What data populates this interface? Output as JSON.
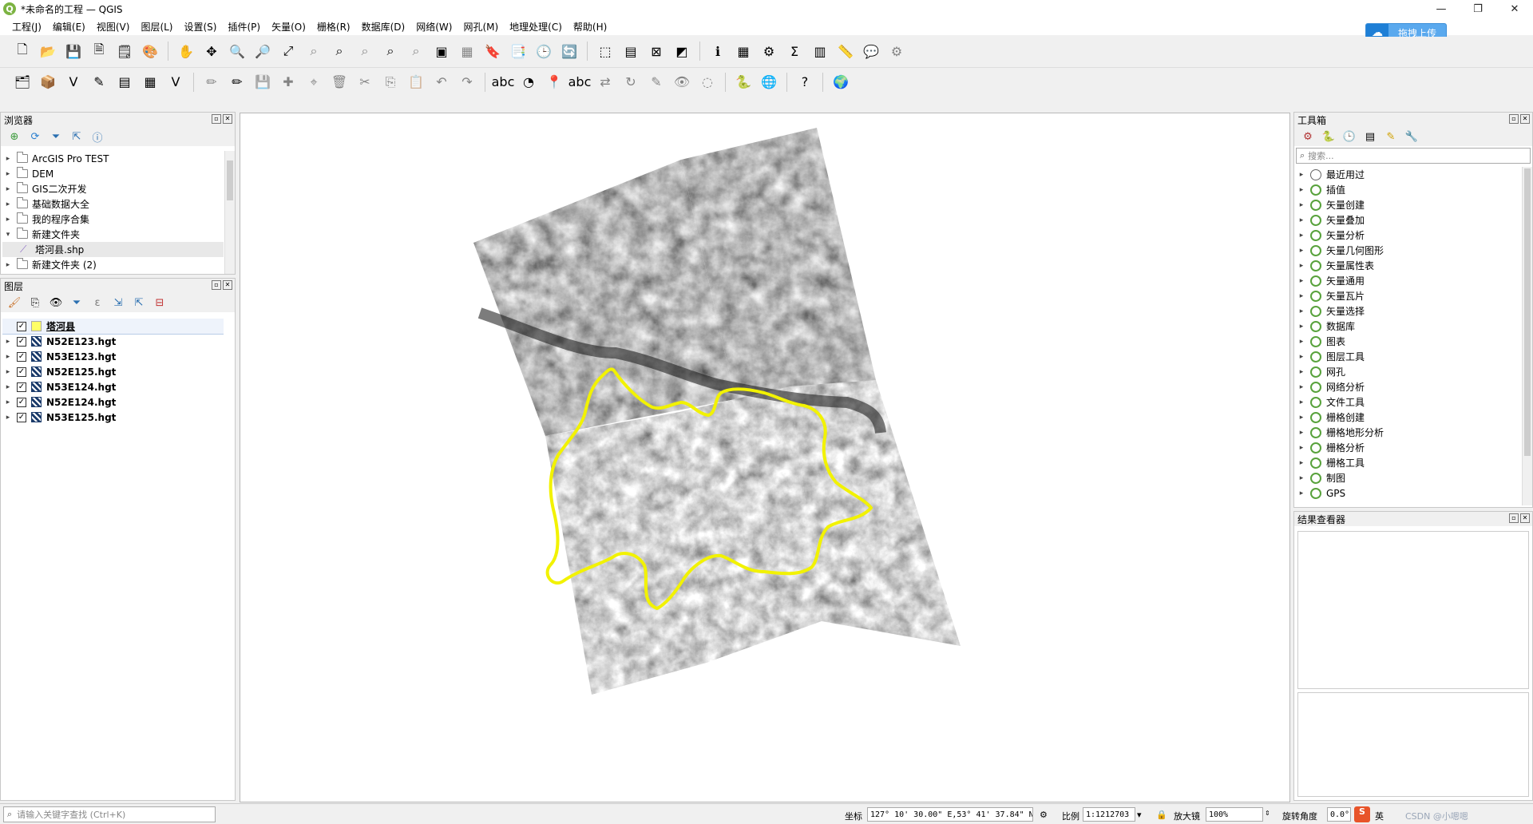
{
  "window": {
    "title": "*未命名的工程 — QGIS",
    "logo": "Q",
    "min": "—",
    "max": "❐",
    "close": "✕"
  },
  "menu": [
    "工程(J)",
    "编辑(E)",
    "视图(V)",
    "图层(L)",
    "设置(S)",
    "插件(P)",
    "矢量(O)",
    "栅格(R)",
    "数据库(D)",
    "网络(W)",
    "网孔(M)",
    "地理处理(C)",
    "帮助(H)"
  ],
  "upload_button": {
    "label": "拖拽上传",
    "icon": "☁"
  },
  "toolbar1": [
    {
      "name": "new-project-icon",
      "glyph": "🗋"
    },
    {
      "name": "open-project-icon",
      "glyph": "📂"
    },
    {
      "name": "save-project-icon",
      "glyph": "💾"
    },
    {
      "name": "save-as-icon",
      "glyph": "🗎"
    },
    {
      "name": "layout-icon",
      "glyph": "🗒"
    },
    {
      "name": "style-manager-icon",
      "glyph": "🎨"
    },
    {
      "sep": true
    },
    {
      "name": "pan-icon",
      "glyph": "✋"
    },
    {
      "name": "pan-to-selection-icon",
      "glyph": "✥"
    },
    {
      "name": "zoom-in-icon",
      "glyph": "🔍"
    },
    {
      "name": "zoom-out-icon",
      "glyph": "🔎"
    },
    {
      "name": "zoom-full-icon",
      "glyph": "⤢"
    },
    {
      "name": "zoom-selection-icon",
      "glyph": "⌕",
      "dim": true
    },
    {
      "name": "zoom-layer-icon",
      "glyph": "⌕"
    },
    {
      "name": "zoom-native-icon",
      "glyph": "⌕",
      "dim": true
    },
    {
      "name": "zoom-last-icon",
      "glyph": "⌕"
    },
    {
      "name": "zoom-next-icon",
      "glyph": "⌕",
      "dim": true
    },
    {
      "name": "new-map-view-icon",
      "glyph": "▣"
    },
    {
      "name": "new-3d-view-icon",
      "glyph": "▦",
      "dim": true
    },
    {
      "name": "bookmark-icon",
      "glyph": "🔖"
    },
    {
      "name": "show-bookmarks-icon",
      "glyph": "📑"
    },
    {
      "name": "temporal-icon",
      "glyph": "🕒"
    },
    {
      "name": "refresh-icon",
      "glyph": "🔄"
    },
    {
      "sep": true
    },
    {
      "name": "select-features-icon",
      "glyph": "⬚"
    },
    {
      "name": "select-value-icon",
      "glyph": "▤"
    },
    {
      "name": "deselect-icon",
      "glyph": "⊠"
    },
    {
      "name": "select-location-icon",
      "glyph": "◩"
    },
    {
      "sep": true
    },
    {
      "name": "identify-icon",
      "glyph": "ℹ"
    },
    {
      "name": "attribute-table-icon",
      "glyph": "▦"
    },
    {
      "name": "toolbox-icon",
      "glyph": "⚙"
    },
    {
      "name": "statistics-icon",
      "glyph": "Σ"
    },
    {
      "name": "field-calculator-icon",
      "glyph": "▥"
    },
    {
      "name": "measure-icon",
      "glyph": "📏"
    },
    {
      "name": "annotation-icon",
      "glyph": "💬"
    },
    {
      "name": "tips-icon",
      "glyph": "⚙",
      "dim": true
    }
  ],
  "toolbar2": [
    {
      "name": "data-source-manager-icon",
      "glyph": "🗂"
    },
    {
      "name": "new-geopackage-icon",
      "glyph": "📦"
    },
    {
      "name": "new-shapefile-icon",
      "glyph": "V"
    },
    {
      "name": "new-temp-layer-icon",
      "glyph": "✎"
    },
    {
      "name": "new-virtual-layer-icon",
      "glyph": "▤"
    },
    {
      "name": "mesh-icon",
      "glyph": "▦"
    },
    {
      "name": "add-vector-icon",
      "glyph": "V"
    },
    {
      "sep": true
    },
    {
      "name": "current-edits-icon",
      "glyph": "✏",
      "dim": true
    },
    {
      "name": "toggle-editing-icon",
      "glyph": "✏"
    },
    {
      "name": "save-edits-icon",
      "glyph": "💾",
      "dim": true
    },
    {
      "name": "add-feature-icon",
      "glyph": "✚",
      "dim": true
    },
    {
      "name": "vertex-tool-icon",
      "glyph": "⌖",
      "dim": true
    },
    {
      "name": "delete-selected-icon",
      "glyph": "🗑",
      "dim": true
    },
    {
      "name": "cut-icon",
      "glyph": "✂",
      "dim": true
    },
    {
      "name": "copy-icon",
      "glyph": "⎘",
      "dim": true
    },
    {
      "name": "paste-icon",
      "glyph": "📋",
      "dim": true
    },
    {
      "name": "undo-icon",
      "glyph": "↶",
      "dim": true
    },
    {
      "name": "redo-icon",
      "glyph": "↷",
      "dim": true
    },
    {
      "sep": true
    },
    {
      "name": "label-icon",
      "glyph": "abc"
    },
    {
      "name": "diagram-icon",
      "glyph": "◔"
    },
    {
      "name": "pin-label-icon",
      "glyph": "📍"
    },
    {
      "name": "highlight-label-icon",
      "glyph": "abc"
    },
    {
      "name": "move-label-icon",
      "glyph": "⇄",
      "dim": true
    },
    {
      "name": "rotate-label-icon",
      "glyph": "↻",
      "dim": true
    },
    {
      "name": "change-label-icon",
      "glyph": "✎",
      "dim": true
    },
    {
      "name": "show-label-icon",
      "glyph": "👁",
      "dim": true
    },
    {
      "name": "hide-label-icon",
      "glyph": "◌",
      "dim": true
    },
    {
      "sep": true
    },
    {
      "name": "python-icon",
      "glyph": "🐍"
    },
    {
      "name": "globe-icon",
      "glyph": "🌐"
    },
    {
      "sep": true
    },
    {
      "name": "help-icon",
      "glyph": "?"
    },
    {
      "sep": true
    },
    {
      "name": "web-icon",
      "glyph": "🌍"
    }
  ],
  "browser": {
    "title": "浏览器",
    "items": [
      {
        "label": "ArcGIS Pro TEST",
        "arrow": "▸",
        "type": "folder"
      },
      {
        "label": "DEM",
        "arrow": "▸",
        "type": "folder"
      },
      {
        "label": "GIS二次开发",
        "arrow": "▸",
        "type": "folder"
      },
      {
        "label": "基础数据大全",
        "arrow": "▸",
        "type": "folder"
      },
      {
        "label": "我的程序合集",
        "arrow": "▸",
        "type": "folder"
      },
      {
        "label": "新建文件夹",
        "arrow": "▾",
        "type": "folder"
      },
      {
        "label": "塔河县.shp",
        "arrow": "",
        "type": "shp",
        "selected": true
      },
      {
        "label": "新建文件夹 (2)",
        "arrow": "▸",
        "type": "folder"
      }
    ]
  },
  "layers": {
    "title": "图层",
    "items": [
      {
        "label": "塔河县",
        "type": "vector",
        "checked": "✓",
        "selected": true
      },
      {
        "label": "N52E123.hgt",
        "type": "raster",
        "checked": "✓"
      },
      {
        "label": "N53E123.hgt",
        "type": "raster",
        "checked": "✓"
      },
      {
        "label": "N52E125.hgt",
        "type": "raster",
        "checked": "✓"
      },
      {
        "label": "N53E124.hgt",
        "type": "raster",
        "checked": "✓"
      },
      {
        "label": "N52E124.hgt",
        "type": "raster",
        "checked": "✓"
      },
      {
        "label": "N53E125.hgt",
        "type": "raster",
        "checked": "✓"
      }
    ]
  },
  "toolbox": {
    "title": "工具箱",
    "search_placeholder": "搜索...",
    "items": [
      "最近用过",
      "插值",
      "矢量创建",
      "矢量叠加",
      "矢量分析",
      "矢量几何图形",
      "矢量属性表",
      "矢量通用",
      "矢量瓦片",
      "矢量选择",
      "数据库",
      "图表",
      "图层工具",
      "网孔",
      "网络分析",
      "文件工具",
      "栅格创建",
      "栅格地形分析",
      "栅格分析",
      "栅格工具",
      "制图",
      "GPS"
    ]
  },
  "results": {
    "title": "结果查看器"
  },
  "statusbar": {
    "locator_placeholder": "请输入关键字查找 (Ctrl+K)",
    "coord_label": "坐标",
    "coord_value": "127° 10' 30.00\" E,53° 41' 37.84\" N",
    "scale_label": "比例",
    "scale_value": "1:1212703",
    "magnifier_label": "放大镜",
    "magnifier_value": "100%",
    "rotation_label": "旋转角度",
    "rotation_value": "0.0°",
    "ime_label": "英",
    "watermark": "CSDN @小嗯嗯"
  },
  "colors": {
    "boundary": "#f2f200",
    "accent": "#5aa9ee"
  }
}
